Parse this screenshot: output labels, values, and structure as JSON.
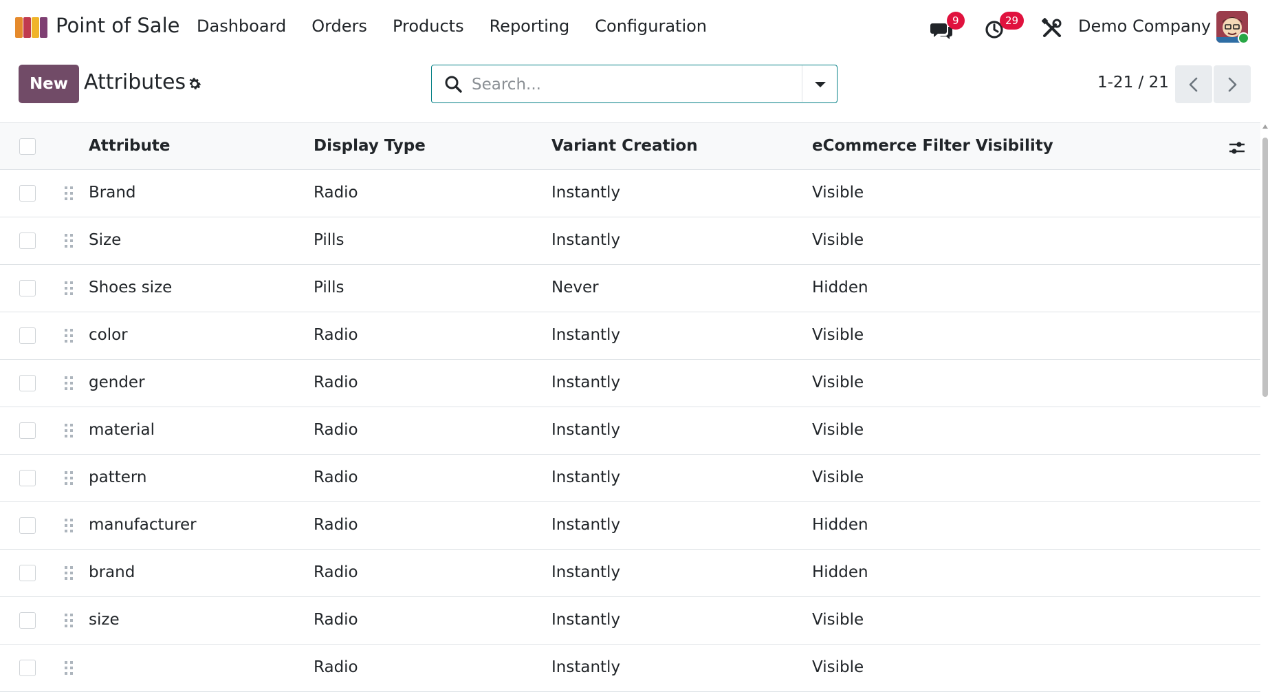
{
  "navbar": {
    "app_name": "Point of Sale",
    "menu": [
      "Dashboard",
      "Orders",
      "Products",
      "Reporting",
      "Configuration"
    ],
    "messages_count": "9",
    "activities_count": "29",
    "company": "Demo Company"
  },
  "control": {
    "new_label": "New",
    "title": "Attributes",
    "search_placeholder": "Search...",
    "pager": "1-21 / 21"
  },
  "table": {
    "headers": [
      "Attribute",
      "Display Type",
      "Variant Creation",
      "eCommerce Filter Visibility"
    ],
    "rows": [
      [
        "Brand",
        "Radio",
        "Instantly",
        "Visible"
      ],
      [
        "Size",
        "Pills",
        "Instantly",
        "Visible"
      ],
      [
        "Shoes size",
        "Pills",
        "Never",
        "Hidden"
      ],
      [
        "color",
        "Radio",
        "Instantly",
        "Visible"
      ],
      [
        "gender",
        "Radio",
        "Instantly",
        "Visible"
      ],
      [
        "material",
        "Radio",
        "Instantly",
        "Visible"
      ],
      [
        "pattern",
        "Radio",
        "Instantly",
        "Visible"
      ],
      [
        "manufacturer",
        "Radio",
        "Instantly",
        "Hidden"
      ],
      [
        "brand",
        "Radio",
        "Instantly",
        "Hidden"
      ],
      [
        "size",
        "Radio",
        "Instantly",
        "Visible"
      ],
      [
        "",
        "Radio",
        "Instantly",
        "Visible"
      ]
    ]
  },
  "colors": {
    "primary": "#714b67",
    "accent": "#017e84",
    "badge": "#e0123e"
  },
  "icons": [
    "pos-logo-icon",
    "chat-icon",
    "clock-icon",
    "tools-icon",
    "gear-icon",
    "search-icon",
    "caret-down-icon",
    "chevron-left-icon",
    "chevron-right-icon",
    "drag-handle-icon",
    "column-settings-icon"
  ]
}
